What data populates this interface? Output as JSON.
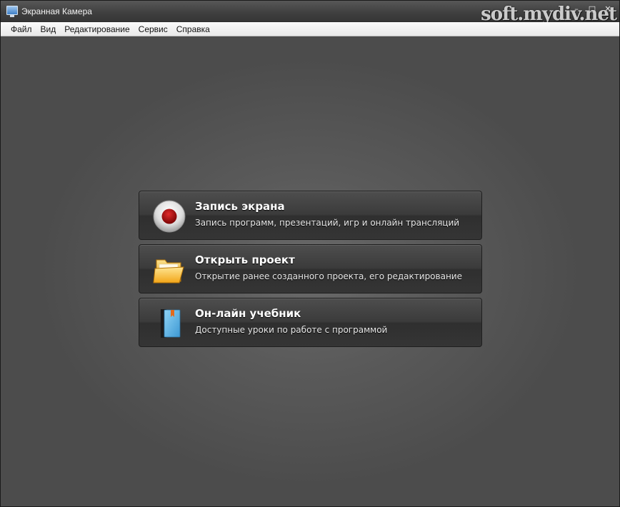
{
  "window": {
    "title": "Экранная Камера",
    "controls": {
      "minimize": "–",
      "maximize": "□",
      "close": "✕"
    },
    "watermark": "soft.mydiv.net"
  },
  "menu": {
    "items": [
      "Файл",
      "Вид",
      "Редактирование",
      "Сервис",
      "Справка"
    ]
  },
  "actions": [
    {
      "title": "Запись экрана",
      "description": "Запись программ, презентаций, игр и онлайн трансляций",
      "icon": "record-icon"
    },
    {
      "title": "Открыть проект",
      "description": "Открытие ранее созданного проекта, его редактирование",
      "icon": "folder-icon"
    },
    {
      "title": "Он-лайн учебник",
      "description": "Доступные уроки по работе с программой",
      "icon": "book-icon"
    }
  ],
  "colors": {
    "record_red": "#c01818",
    "folder_yellow": "#f6b82a",
    "book_blue": "#5fb3e6"
  }
}
